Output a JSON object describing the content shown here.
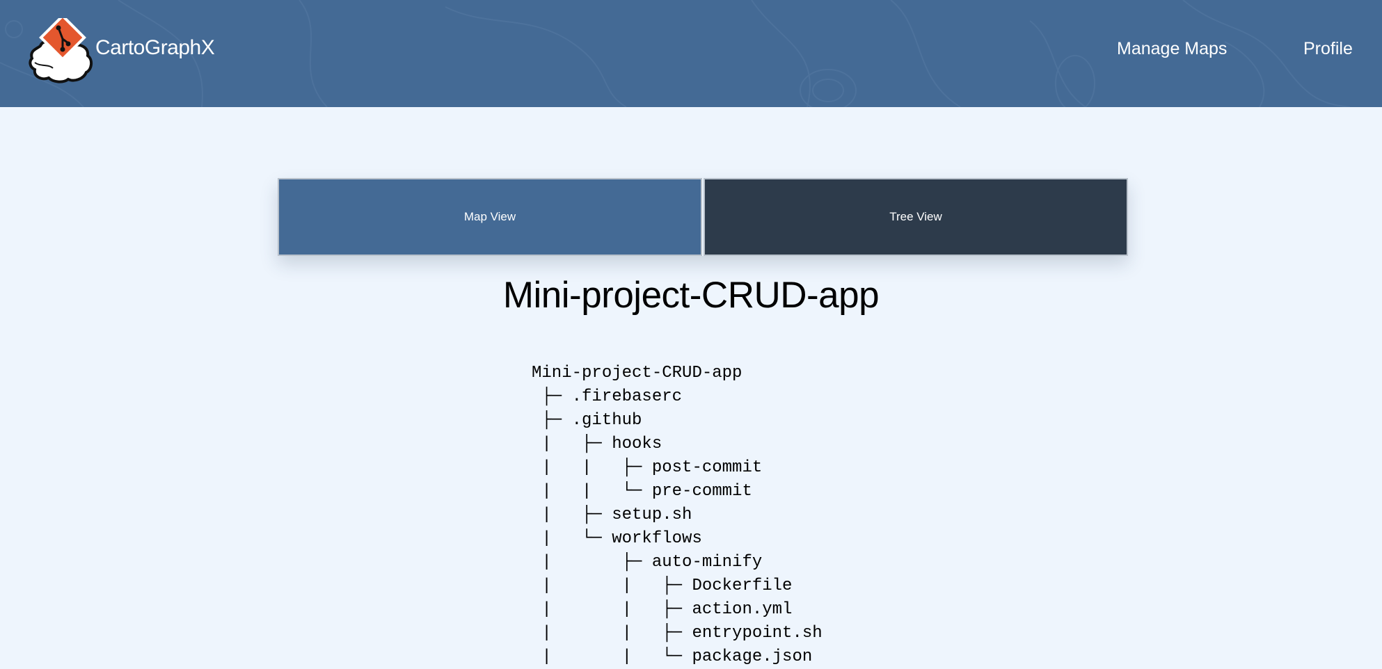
{
  "app": {
    "brand": "CartoGraphX",
    "logo_icon": "git-map-logo-icon"
  },
  "nav": {
    "manage_maps": "Manage Maps",
    "profile": "Profile"
  },
  "view_toggle": {
    "map_view": "Map View",
    "tree_view": "Tree View",
    "active": "Tree View"
  },
  "colors": {
    "header": "#446a95",
    "page_background": "#eef5fd",
    "map_view_button": "#446a95",
    "tree_view_button": "#2d3b4b"
  },
  "page": {
    "title": "Mini-project-CRUD-app"
  },
  "tree": {
    "lines": [
      "Mini-project-CRUD-app",
      " ├─ .firebaserc",
      " ├─ .github",
      " |   ├─ hooks",
      " |   |   ├─ post-commit",
      " |   |   └─ pre-commit",
      " |   ├─ setup.sh",
      " |   └─ workflows",
      " |       ├─ auto-minify",
      " |       |   ├─ Dockerfile",
      " |       |   ├─ action.yml",
      " |       |   ├─ entrypoint.sh",
      " |       |   └─ package.json"
    ]
  }
}
